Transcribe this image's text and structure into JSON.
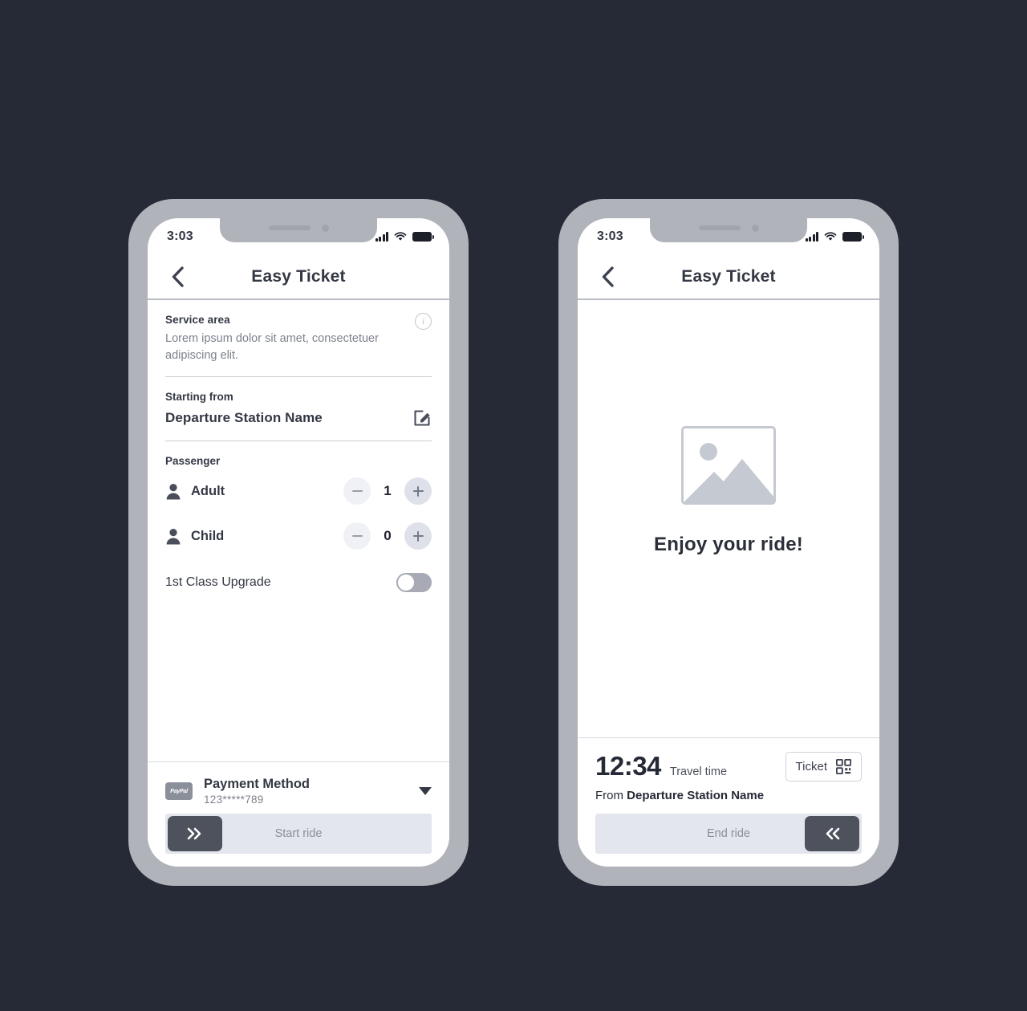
{
  "background_color": "#262a36",
  "phone_frame_color": "#b0b3ba",
  "accent_dark": "#4e525d",
  "muted_text": "#7e828d",
  "screen1": {
    "status": {
      "time": "3:03",
      "signal_icon": "signal-bars-icon",
      "wifi_icon": "wifi-icon",
      "battery_icon": "battery-full-icon"
    },
    "appbar": {
      "title": "Easy Ticket",
      "back_icon": "chevron-left-icon"
    },
    "service_area": {
      "title": "Service area",
      "description": "Lorem ipsum dolor sit amet, consectetuer adipiscing elit.",
      "info_icon": "info-circle-icon",
      "info_glyph": "i"
    },
    "starting_from": {
      "label": "Starting from",
      "value": "Departure Station Name",
      "edit_icon": "edit-pencil-icon"
    },
    "passenger": {
      "label": "Passenger",
      "rows": [
        {
          "icon": "person-icon",
          "name": "Adult",
          "count": "1",
          "minus_icon": "minus-icon",
          "plus_icon": "plus-icon"
        },
        {
          "icon": "person-icon",
          "name": "Child",
          "count": "0",
          "minus_icon": "minus-icon",
          "plus_icon": "plus-icon"
        }
      ]
    },
    "upgrade": {
      "label": "1st Class Upgrade",
      "toggle_state": "off",
      "toggle_icon": "toggle-switch-icon"
    },
    "payment": {
      "brand": "PayPal",
      "brand_icon": "paypal-logo-icon",
      "title": "Payment Method",
      "masked_number": "123*****789",
      "caret_icon": "caret-down-icon"
    },
    "start_ride": {
      "label": "Start ride",
      "handle_icon": "double-chevron-right-icon"
    }
  },
  "screen2": {
    "status": {
      "time": "3:03",
      "signal_icon": "signal-bars-icon",
      "wifi_icon": "wifi-icon",
      "battery_icon": "battery-full-icon"
    },
    "appbar": {
      "title": "Easy Ticket",
      "back_icon": "chevron-left-icon"
    },
    "hero": {
      "image_icon": "image-placeholder-icon",
      "title": "Enjoy your ride!"
    },
    "ride": {
      "time": "12:34",
      "time_label": "Travel time",
      "from_prefix": "From",
      "from_station": "Departure Station Name",
      "ticket_label": "Ticket",
      "ticket_icon": "qr-code-icon",
      "end_ride_label": "End ride",
      "handle_icon": "double-chevron-left-icon"
    }
  }
}
